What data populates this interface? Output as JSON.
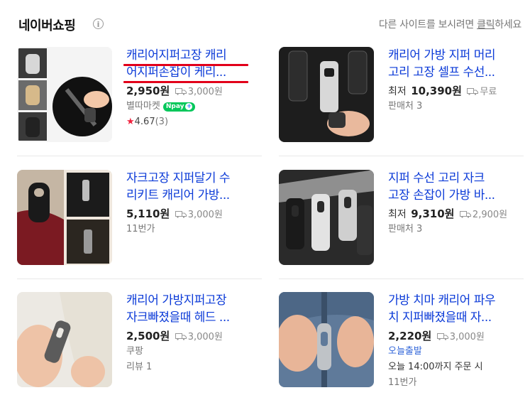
{
  "header": {
    "title": "네이버쇼핑",
    "info_icon": "i",
    "notice_before": "다른 사이트를 보시려면 ",
    "notice_link": "클릭",
    "notice_after": "하세요"
  },
  "products": [
    {
      "title1": "캐리어지퍼고장 캐리",
      "title2": "어지퍼손잡이 케리...",
      "price": "2,950원",
      "price_prefix": "",
      "shipping": "3,000원",
      "seller": "별따마켓",
      "npay": "Npay",
      "rating_star": "★",
      "rating": "4.67",
      "rating_count": "(3)"
    },
    {
      "title1": "캐리어 가방 지퍼 머리",
      "title2": "고리 고장 셀프 수선...",
      "price": "10,390원",
      "price_prefix": "최저",
      "shipping": "무료",
      "seller": "판매처 3"
    },
    {
      "title1": "자크고장 지퍼달기 수",
      "title2": "리키트 캐리어 가방...",
      "price": "5,110원",
      "price_prefix": "",
      "shipping": "3,000원",
      "seller": "11번가"
    },
    {
      "title1": "지퍼 수선 고리 자크",
      "title2": "고장 손잡이 가방 바...",
      "price": "9,310원",
      "price_prefix": "최저",
      "shipping": "2,900원",
      "seller": "판매처 3"
    },
    {
      "title1": "캐리어 가방지퍼고장",
      "title2": "자크빠졌을때 헤드 ...",
      "price": "2,500원",
      "price_prefix": "",
      "shipping": "3,000원",
      "seller": "쿠팡",
      "reviews": "리뷰 1"
    },
    {
      "title1": "가방 치마 캐리어 파우",
      "title2": "치 지퍼빠졌을때 자...",
      "price": "2,220원",
      "price_prefix": "",
      "shipping": "3,000원",
      "delivery": "오늘출발",
      "order_info": "오늘 14:00까지 주문 시",
      "seller": "11번가"
    }
  ],
  "colors": {
    "link": "#0c3bd8",
    "npay": "#03c75a",
    "highlight": "#e2001a",
    "today": "#2f64d9"
  }
}
